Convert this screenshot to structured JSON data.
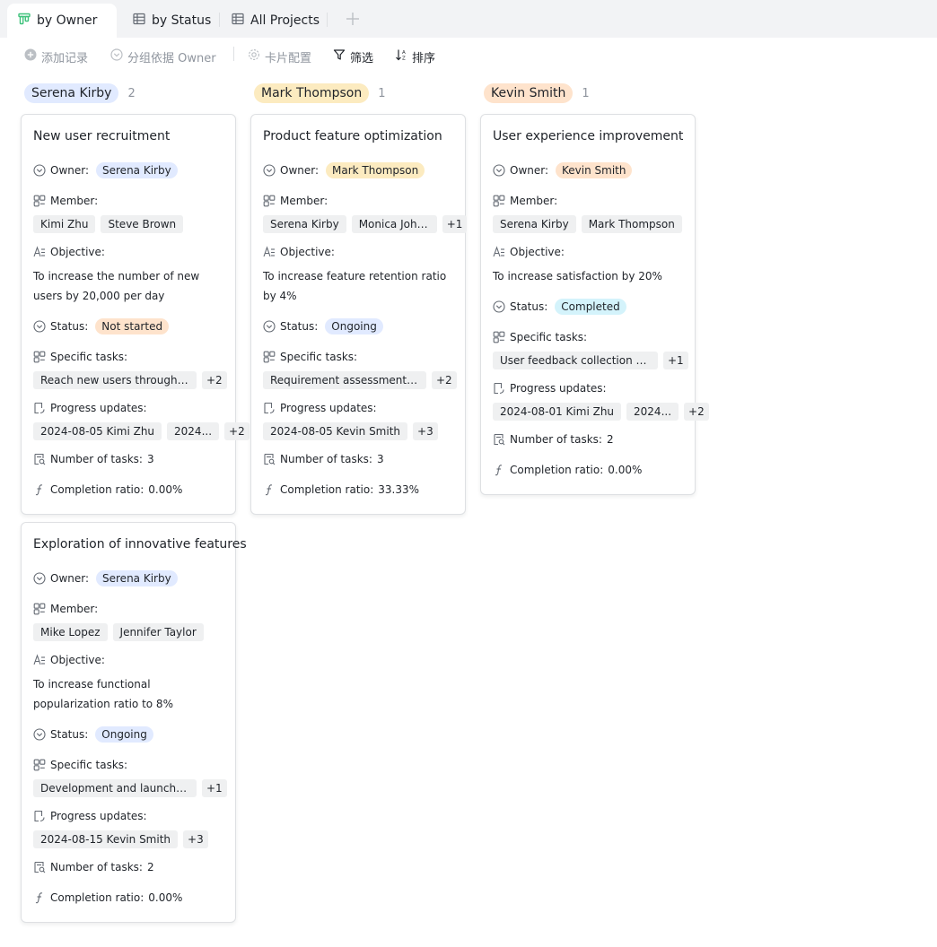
{
  "tabs": [
    {
      "label": "by Owner",
      "active": true
    },
    {
      "label": "by Status",
      "active": false
    },
    {
      "label": "All Projects",
      "active": false
    }
  ],
  "toolbar": {
    "add_record": "添加记录",
    "group_by": "分组依据 Owner",
    "card_config": "卡片配置",
    "filter": "筛选",
    "sort": "排序"
  },
  "colors": {
    "blue": "#e1eaff",
    "yellow": "#fcebc0",
    "orange": "#fee3cc",
    "cyan": "#d4f3fb",
    "accent_green": "#3ec27b"
  },
  "labels": {
    "owner": "Owner:",
    "member": "Member:",
    "objective": "Objective:",
    "status": "Status:",
    "specific_tasks": "Specific tasks:",
    "progress_updates": "Progress updates:",
    "number_of_tasks": "Number of tasks:",
    "completion_ratio": "Completion ratio:"
  },
  "columns": [
    {
      "owner": "Serena Kirby",
      "count": "2",
      "cards": [
        {
          "title": "New user recruitment",
          "owner": "Serena Kirby",
          "members": [
            "Kimi Zhu",
            "Steve Brown"
          ],
          "members_more": "",
          "objective": "To increase the number of new users by 20,000 per day",
          "status": "Not started",
          "tasks": [
            "Reach new users through mu..."
          ],
          "tasks_more": "+2",
          "progress": [
            "2024-08-05 Kimi Zhu",
            "2024..."
          ],
          "progress_more": "+2",
          "num_tasks": "3",
          "completion": "0.00%"
        },
        {
          "title": "Exploration of innovative features",
          "owner": "Serena Kirby",
          "members": [
            "Mike Lopez",
            "Jennifer Taylor"
          ],
          "members_more": "",
          "objective": "To increase functional popularization ratio to 8%",
          "status": "Ongoing",
          "tasks": [
            "Development and launch of i..."
          ],
          "tasks_more": "+1",
          "progress": [
            "2024-08-15 Kevin Smith"
          ],
          "progress_more": "+3",
          "num_tasks": "2",
          "completion": "0.00%"
        }
      ]
    },
    {
      "owner": "Mark Thompson",
      "count": "1",
      "cards": [
        {
          "title": "Product feature optimization",
          "owner": "Mark Thompson",
          "members": [
            "Serena Kirby",
            "Monica John..."
          ],
          "members_more": "+1",
          "objective": "To increase feature retention ratio by 4%",
          "status": "Ongoing",
          "tasks": [
            "Requirement assessment and..."
          ],
          "tasks_more": "+2",
          "progress": [
            "2024-08-05 Kevin Smith"
          ],
          "progress_more": "+3",
          "num_tasks": "3",
          "completion": "33.33%"
        }
      ]
    },
    {
      "owner": "Kevin Smith",
      "count": "1",
      "cards": [
        {
          "title": "User experience improvement",
          "owner": "Kevin Smith",
          "members": [
            "Serena Kirby",
            "Mark Thompson"
          ],
          "members_more": "",
          "objective": "To increase satisfaction by 20%",
          "status": "Completed",
          "tasks": [
            "User feedback collection and ..."
          ],
          "tasks_more": "+1",
          "progress": [
            "2024-08-01 Kimi Zhu",
            "2024..."
          ],
          "progress_more": "+2",
          "num_tasks": "2",
          "completion": "0.00%"
        }
      ]
    }
  ]
}
